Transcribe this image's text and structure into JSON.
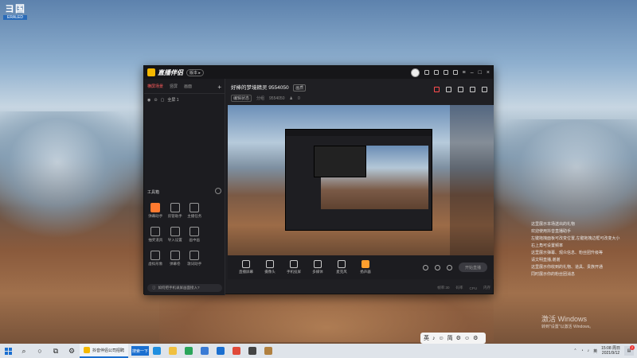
{
  "desktop": {
    "logo_text": "ヨ国",
    "logo_sub": "ERALED"
  },
  "app": {
    "name": "直播伴侣",
    "version_badge": "版本 ▸",
    "scene_tabs": [
      {
        "label": "横屏场景",
        "active": true
      },
      {
        "label": "竖屏",
        "active": false
      },
      {
        "label": "画面",
        "active": false
      }
    ],
    "add_scene": "+",
    "source_item": "全屏 1",
    "tools_title": "工具箱",
    "tools": [
      {
        "label": "弹幕助手",
        "hot": true
      },
      {
        "label": "房管助手",
        "hot": false
      },
      {
        "label": "主播任务",
        "hot": false
      },
      {
        "label": "",
        "hot": false
      },
      {
        "label": "抽奖道具",
        "hot": false
      },
      {
        "label": "导入设置",
        "hot": false
      },
      {
        "label": "画中画",
        "hot": false
      },
      {
        "label": "",
        "hot": false
      },
      {
        "label": "虚拟形象",
        "hot": false
      },
      {
        "label": "弹幕卷",
        "hot": false
      },
      {
        "label": "歌词助手",
        "hot": false
      },
      {
        "label": "",
        "hot": false
      }
    ],
    "hint": "如何把手机录屏画面接入?",
    "room": {
      "title": "好棒的梦境精灵 9554050",
      "tag": "画质",
      "edit": "编辑状态",
      "category": "分组",
      "id": "9554050",
      "count": "0"
    },
    "controls": [
      {
        "label": "直播屏幕"
      },
      {
        "label": "摄像头"
      },
      {
        "label": "手机投屏"
      },
      {
        "label": "多媒体"
      },
      {
        "label": "麦克风"
      },
      {
        "label": "扬声器"
      }
    ],
    "live_button": "开始直播",
    "status": [
      "帧率:30",
      "码率",
      "CPU",
      "内存"
    ]
  },
  "chat_messages": [
    "这里展示本场送出的礼物",
    "欢迎使用抖音直播助手",
    "左键拖拽面板可改变位置,左键拖拽边框可改变大小",
    "右上角可设置频率",
    "这里展示弹幕、观众信息、粉丝团升级等",
    "请文明直播,谢谢",
    "这里展示你收到的礼物、道具、贵族开通",
    "同时展示你的粉丝团消息"
  ],
  "watermark": {
    "line1": "激活 Windows",
    "line2": "转到\"设置\"以激活 Windows。"
  },
  "ime": [
    "英",
    "♪",
    "☺",
    "简",
    "⚙",
    "☺",
    "⚙"
  ],
  "taskbar": {
    "start_icon": "windows-logo",
    "active_app": "抖音伴侣公司招聘",
    "search_label": "搜索一下",
    "time": "15:08 周日",
    "date": "2021/9/12",
    "notifications": "2",
    "lang": "英"
  }
}
